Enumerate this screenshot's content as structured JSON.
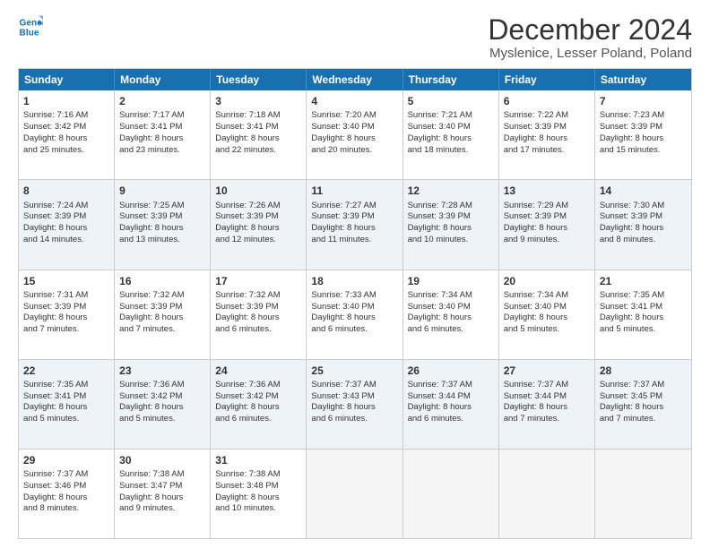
{
  "header": {
    "logo_line1": "General",
    "logo_line2": "Blue",
    "title": "December 2024",
    "subtitle": "Myslenice, Lesser Poland, Poland"
  },
  "days_of_week": [
    "Sunday",
    "Monday",
    "Tuesday",
    "Wednesday",
    "Thursday",
    "Friday",
    "Saturday"
  ],
  "rows": [
    [
      {
        "num": "1",
        "lines": [
          "Sunrise: 7:16 AM",
          "Sunset: 3:42 PM",
          "Daylight: 8 hours",
          "and 25 minutes."
        ]
      },
      {
        "num": "2",
        "lines": [
          "Sunrise: 7:17 AM",
          "Sunset: 3:41 PM",
          "Daylight: 8 hours",
          "and 23 minutes."
        ]
      },
      {
        "num": "3",
        "lines": [
          "Sunrise: 7:18 AM",
          "Sunset: 3:41 PM",
          "Daylight: 8 hours",
          "and 22 minutes."
        ]
      },
      {
        "num": "4",
        "lines": [
          "Sunrise: 7:20 AM",
          "Sunset: 3:40 PM",
          "Daylight: 8 hours",
          "and 20 minutes."
        ]
      },
      {
        "num": "5",
        "lines": [
          "Sunrise: 7:21 AM",
          "Sunset: 3:40 PM",
          "Daylight: 8 hours",
          "and 18 minutes."
        ]
      },
      {
        "num": "6",
        "lines": [
          "Sunrise: 7:22 AM",
          "Sunset: 3:39 PM",
          "Daylight: 8 hours",
          "and 17 minutes."
        ]
      },
      {
        "num": "7",
        "lines": [
          "Sunrise: 7:23 AM",
          "Sunset: 3:39 PM",
          "Daylight: 8 hours",
          "and 15 minutes."
        ]
      }
    ],
    [
      {
        "num": "8",
        "lines": [
          "Sunrise: 7:24 AM",
          "Sunset: 3:39 PM",
          "Daylight: 8 hours",
          "and 14 minutes."
        ]
      },
      {
        "num": "9",
        "lines": [
          "Sunrise: 7:25 AM",
          "Sunset: 3:39 PM",
          "Daylight: 8 hours",
          "and 13 minutes."
        ]
      },
      {
        "num": "10",
        "lines": [
          "Sunrise: 7:26 AM",
          "Sunset: 3:39 PM",
          "Daylight: 8 hours",
          "and 12 minutes."
        ]
      },
      {
        "num": "11",
        "lines": [
          "Sunrise: 7:27 AM",
          "Sunset: 3:39 PM",
          "Daylight: 8 hours",
          "and 11 minutes."
        ]
      },
      {
        "num": "12",
        "lines": [
          "Sunrise: 7:28 AM",
          "Sunset: 3:39 PM",
          "Daylight: 8 hours",
          "and 10 minutes."
        ]
      },
      {
        "num": "13",
        "lines": [
          "Sunrise: 7:29 AM",
          "Sunset: 3:39 PM",
          "Daylight: 8 hours",
          "and 9 minutes."
        ]
      },
      {
        "num": "14",
        "lines": [
          "Sunrise: 7:30 AM",
          "Sunset: 3:39 PM",
          "Daylight: 8 hours",
          "and 8 minutes."
        ]
      }
    ],
    [
      {
        "num": "15",
        "lines": [
          "Sunrise: 7:31 AM",
          "Sunset: 3:39 PM",
          "Daylight: 8 hours",
          "and 7 minutes."
        ]
      },
      {
        "num": "16",
        "lines": [
          "Sunrise: 7:32 AM",
          "Sunset: 3:39 PM",
          "Daylight: 8 hours",
          "and 7 minutes."
        ]
      },
      {
        "num": "17",
        "lines": [
          "Sunrise: 7:32 AM",
          "Sunset: 3:39 PM",
          "Daylight: 8 hours",
          "and 6 minutes."
        ]
      },
      {
        "num": "18",
        "lines": [
          "Sunrise: 7:33 AM",
          "Sunset: 3:40 PM",
          "Daylight: 8 hours",
          "and 6 minutes."
        ]
      },
      {
        "num": "19",
        "lines": [
          "Sunrise: 7:34 AM",
          "Sunset: 3:40 PM",
          "Daylight: 8 hours",
          "and 6 minutes."
        ]
      },
      {
        "num": "20",
        "lines": [
          "Sunrise: 7:34 AM",
          "Sunset: 3:40 PM",
          "Daylight: 8 hours",
          "and 5 minutes."
        ]
      },
      {
        "num": "21",
        "lines": [
          "Sunrise: 7:35 AM",
          "Sunset: 3:41 PM",
          "Daylight: 8 hours",
          "and 5 minutes."
        ]
      }
    ],
    [
      {
        "num": "22",
        "lines": [
          "Sunrise: 7:35 AM",
          "Sunset: 3:41 PM",
          "Daylight: 8 hours",
          "and 5 minutes."
        ]
      },
      {
        "num": "23",
        "lines": [
          "Sunrise: 7:36 AM",
          "Sunset: 3:42 PM",
          "Daylight: 8 hours",
          "and 5 minutes."
        ]
      },
      {
        "num": "24",
        "lines": [
          "Sunrise: 7:36 AM",
          "Sunset: 3:42 PM",
          "Daylight: 8 hours",
          "and 6 minutes."
        ]
      },
      {
        "num": "25",
        "lines": [
          "Sunrise: 7:37 AM",
          "Sunset: 3:43 PM",
          "Daylight: 8 hours",
          "and 6 minutes."
        ]
      },
      {
        "num": "26",
        "lines": [
          "Sunrise: 7:37 AM",
          "Sunset: 3:44 PM",
          "Daylight: 8 hours",
          "and 6 minutes."
        ]
      },
      {
        "num": "27",
        "lines": [
          "Sunrise: 7:37 AM",
          "Sunset: 3:44 PM",
          "Daylight: 8 hours",
          "and 7 minutes."
        ]
      },
      {
        "num": "28",
        "lines": [
          "Sunrise: 7:37 AM",
          "Sunset: 3:45 PM",
          "Daylight: 8 hours",
          "and 7 minutes."
        ]
      }
    ],
    [
      {
        "num": "29",
        "lines": [
          "Sunrise: 7:37 AM",
          "Sunset: 3:46 PM",
          "Daylight: 8 hours",
          "and 8 minutes."
        ]
      },
      {
        "num": "30",
        "lines": [
          "Sunrise: 7:38 AM",
          "Sunset: 3:47 PM",
          "Daylight: 8 hours",
          "and 9 minutes."
        ]
      },
      {
        "num": "31",
        "lines": [
          "Sunrise: 7:38 AM",
          "Sunset: 3:48 PM",
          "Daylight: 8 hours",
          "and 10 minutes."
        ]
      },
      {
        "num": "",
        "lines": []
      },
      {
        "num": "",
        "lines": []
      },
      {
        "num": "",
        "lines": []
      },
      {
        "num": "",
        "lines": []
      }
    ]
  ]
}
